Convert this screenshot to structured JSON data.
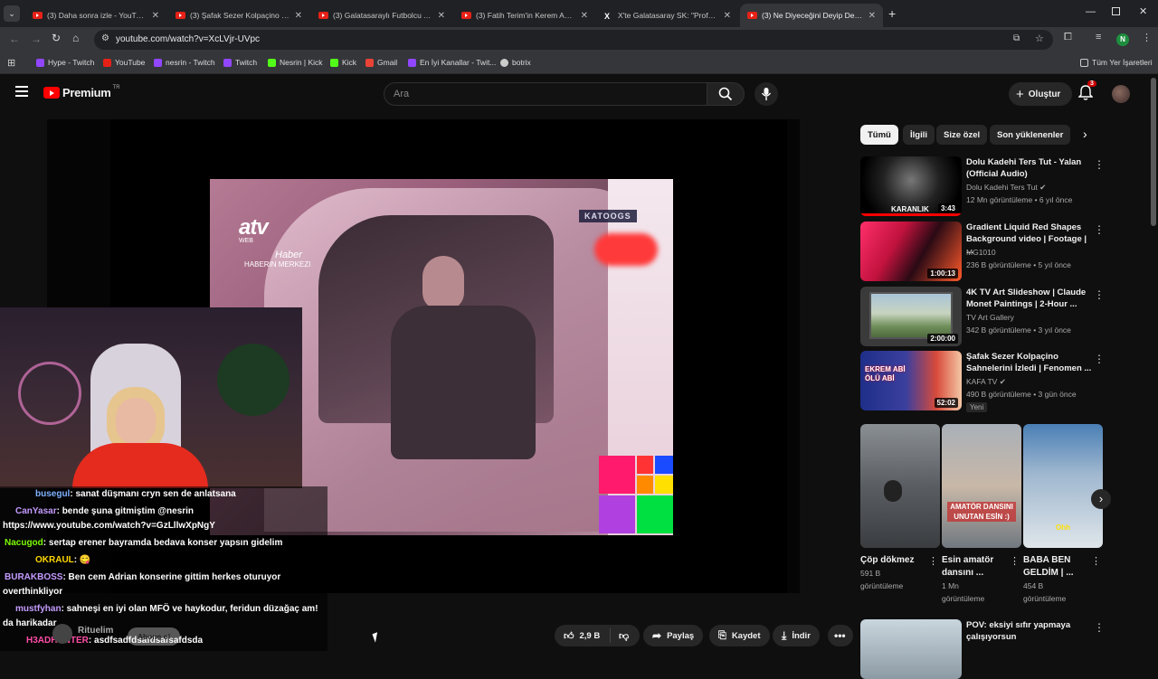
{
  "browser": {
    "tabs": [
      {
        "title": "(3) Daha sonra izle - YouTube",
        "icon": "youtube-icon"
      },
      {
        "title": "(3) Şafak Sezer Kolpaçino Sahne",
        "icon": "youtube-icon"
      },
      {
        "title": "(3) Galatasaraylı Futbolcu Ahme",
        "icon": "youtube-icon"
      },
      {
        "title": "(3) Fatih Terim'in Kerem Aktürk",
        "icon": "youtube-icon"
      },
      {
        "title": "X'te Galatasaray SK: \"Profesyon",
        "icon": "x-icon"
      },
      {
        "title": "(3) Ne Diyeceğini Deyip Demey",
        "icon": "youtube-icon",
        "active": true
      }
    ],
    "new_tab": "+",
    "url": "youtube.com/watch?v=XcLVjr-UVpc",
    "profile_initial": "N",
    "bookmarks": [
      {
        "label": "Hype - Twitch",
        "color": "#9146ff"
      },
      {
        "label": "YouTube",
        "color": "#e62117"
      },
      {
        "label": "nesrin - Twitch",
        "color": "#9146ff"
      },
      {
        "label": "Twitch",
        "color": "#9146ff"
      },
      {
        "label": "Nesrin | Kick",
        "color": "#53fc18"
      },
      {
        "label": "Kick",
        "color": "#53fc18"
      },
      {
        "label": "Gmail",
        "color": "#ea4335"
      },
      {
        "label": "En İyi Kanallar - Twit...",
        "color": "#9146ff"
      },
      {
        "label": "botrix",
        "color": "#cccccc"
      }
    ],
    "all_bookmarks": "Tüm Yer İşaretleri"
  },
  "masthead": {
    "logo": "Premium",
    "region": "TR",
    "search_placeholder": "Ara",
    "create_label": "Oluştur",
    "notif_count": "3"
  },
  "player": {
    "channel_logo": "atv",
    "channel_sub1": "WEB",
    "channel_sub2": "Haber",
    "channel_sub3": "HABERIN MERKEZI",
    "tag": "KATOOGS"
  },
  "chat": [
    {
      "user": "busegul",
      "color": "#7fb2ff",
      "text": ": sanat düşmanı cryn sen de anlatsana"
    },
    {
      "user": "CanYasar",
      "color": "#c49bff",
      "text": ": bende şuna gitmiştim @nesrin"
    },
    {
      "user": "",
      "color": "#ffffff",
      "text": "https://www.youtube.com/watch?v=GzLllwXpNgY"
    },
    {
      "user": "Nacugod",
      "color": "#7cfc00",
      "text": ": sertap erener bayramda bedava konser yapsın gidelim"
    },
    {
      "user": "OKRAUL",
      "color": "#ffd700",
      "text": ": 😋"
    },
    {
      "user": "BURAKBOSS",
      "color": "#c49bff",
      "text": ": Ben cem Adrian konserine gittim herkes oturuyor"
    },
    {
      "user": "",
      "color": "#ffffff",
      "text": "overthinkliyor"
    },
    {
      "user": "mustfyhan",
      "color": "#c49bff",
      "text": ": sahneşi en iyi olan MFÖ ve haykodur, feridun düzağaç am!"
    },
    {
      "user": "",
      "color": "#ffffff",
      "text": "da harikadar"
    },
    {
      "user": "H3ADHUNTER",
      "color": "#ff4da6",
      "text": ": asdfsadfdsafdsafsafdsda"
    }
  ],
  "video_channel": "Rituelim",
  "subscribe_ghost": "Abone ol",
  "actions": {
    "likes": "2,9 B",
    "share": "Paylaş",
    "save": "Kaydet",
    "download": "İndir"
  },
  "chips": [
    "Tümü",
    "İlgili",
    "Size özel",
    "Son yüklenenler"
  ],
  "recommendations": [
    {
      "title": "Dolu Kadehi Ters Tut - Yalan (Official Audio)",
      "channel": "Dolu Kadehi Ters Tut",
      "verified": true,
      "meta": "12 Mn görüntüleme • 6 yıl önce",
      "duration": "3:43",
      "thumb_text": "KARANLIK"
    },
    {
      "title": "Gradient Liquid Red Shapes Background video | Footage | ...",
      "channel": "MG1010",
      "verified": false,
      "meta": "236 B görüntüleme • 5 yıl önce",
      "duration": "1:00:13"
    },
    {
      "title": "4K TV Art Slideshow | Claude Monet Paintings | 2-Hour ...",
      "channel": "TV Art Gallery",
      "verified": false,
      "meta": "342 B görüntüleme • 3 yıl önce",
      "duration": "2:00:00"
    },
    {
      "title": "Şafak Sezer Kolpaçino Sahnelerini İzledi | Fenomen ...",
      "channel": "KAFA TV",
      "verified": true,
      "meta": "490 B görüntüleme • 3 gün önce",
      "duration": "52:02",
      "badge": "Yeni",
      "thumb_text": "EKREM ABİ ÖLÜ ABİ"
    }
  ],
  "shorts": [
    {
      "title": "Çöp dökmez",
      "meta1": "591 B",
      "meta2": "görüntüleme"
    },
    {
      "title": "Esin amatör dansını ...",
      "meta1": "1 Mn",
      "meta2": "görüntüleme",
      "thumb_text": "AMATÖR DANSINI UNUTAN ESİN :)"
    },
    {
      "title": "BABA BEN GELDİM | ...",
      "meta1": "454 B",
      "meta2": "görüntüleme",
      "thumb_text": "Ohh"
    }
  ],
  "next_rec": {
    "title": "POV: eksiyi sıfır yapmaya çalışıyorsun"
  }
}
